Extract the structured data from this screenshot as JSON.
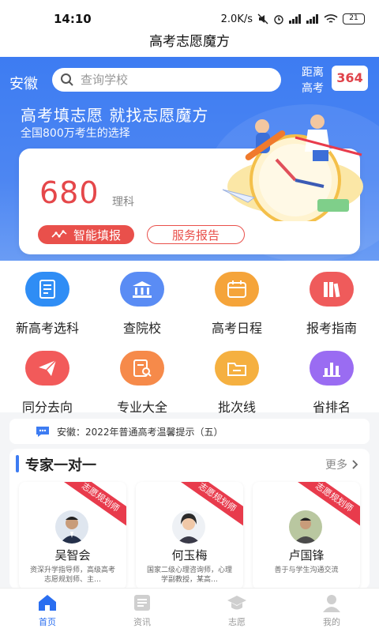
{
  "status_bar": {
    "time": "14:10",
    "speed": "2.0K/s",
    "battery": "21"
  },
  "app_title": "高考志愿魔方",
  "header": {
    "region": "安徽",
    "search_placeholder": "查询学校",
    "countdown_label": "距离高考",
    "countdown_days": "364"
  },
  "hero": {
    "slogan": "高考填志愿 就找志愿魔方",
    "sub_slogan": "全国800万考生的选择"
  },
  "score_card": {
    "score": "680",
    "subject": "理科",
    "smart_fill_label": "智能填报",
    "service_report_label": "服务报告"
  },
  "grid": [
    {
      "label": "新高考选科",
      "icon": "document-icon",
      "color": "#2f8df5"
    },
    {
      "label": "查院校",
      "icon": "building-icon",
      "color": "#5a8cf4"
    },
    {
      "label": "高考日程",
      "icon": "calendar-icon",
      "color": "#f5a43a"
    },
    {
      "label": "报考指南",
      "icon": "books-icon",
      "color": "#ef5b5b"
    },
    {
      "label": "同分去向",
      "icon": "paper-plane-icon",
      "color": "#f25a5a"
    },
    {
      "label": "专业大全",
      "icon": "search-doc-icon",
      "color": "#f68a4a"
    },
    {
      "label": "批次线",
      "icon": "folder-icon",
      "color": "#f5b040"
    },
    {
      "label": "省排名",
      "icon": "bar-chart-icon",
      "color": "#9a6cf2"
    }
  ],
  "notice": {
    "text": "安徽：2022年普通高考温馨提示（五）"
  },
  "experts_section": {
    "title": "专家一对一",
    "more_label": "更多",
    "ribbon_label": "志愿规划师",
    "experts": [
      {
        "name": "吴智会",
        "desc": "资深升学指导师，高级高考志愿规划师、主…"
      },
      {
        "name": "何玉梅",
        "desc": "国家二级心理咨询师，心理学副教授，某高…"
      },
      {
        "name": "卢国锋",
        "desc": "善于与学生沟通交流"
      }
    ]
  },
  "tabs": [
    {
      "label": "首页",
      "icon": "home-icon",
      "active": true
    },
    {
      "label": "资讯",
      "icon": "news-icon",
      "active": false
    },
    {
      "label": "志愿",
      "icon": "graduation-cap-icon",
      "active": false
    },
    {
      "label": "我的",
      "icon": "user-icon",
      "active": false
    }
  ],
  "colors": {
    "primary_blue": "#3d7cf2",
    "accent_red": "#e5474a",
    "ribbon_red": "#e83b4c"
  }
}
